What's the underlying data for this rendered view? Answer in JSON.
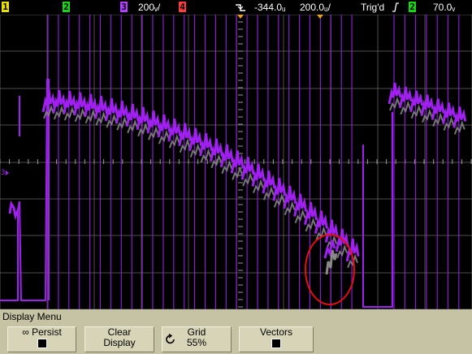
{
  "status_bar": {
    "ch1": {
      "label": "1",
      "color": "#e8e000"
    },
    "ch2": {
      "label": "2",
      "color": "#16d616"
    },
    "ch3": {
      "label": "3",
      "color": "#b040ff",
      "scale": "200ᵥ/"
    },
    "ch4": {
      "label": "4",
      "color": "#ff3b3b"
    },
    "trigger_icon": "falling-edge-trigger-icon",
    "position": "-344.0ᵤ",
    "timebase": "200.0ᵤ/",
    "trigger_state": "Trig'd",
    "edge_icon": "rising-edge-icon",
    "trigger_source": {
      "label": "2",
      "color": "#16d616"
    },
    "trigger_level": "70.0ᵥ"
  },
  "screen": {
    "channel_marker": "3",
    "trace_color": "#a020f0",
    "persist_color": "#8a8a8a",
    "grid_color": "#6f6f6f",
    "highlight_color": "#e01010"
  },
  "menu": {
    "title": "Display Menu",
    "softkeys": [
      {
        "line1": "∞ Persist",
        "has_box": true
      },
      {
        "line1": "Clear",
        "line2": "Display"
      },
      {
        "line1": "Grid",
        "line2": "55%",
        "icon": "rotate-knob-icon"
      },
      {
        "line1": "Vectors",
        "has_box": true
      }
    ]
  }
}
